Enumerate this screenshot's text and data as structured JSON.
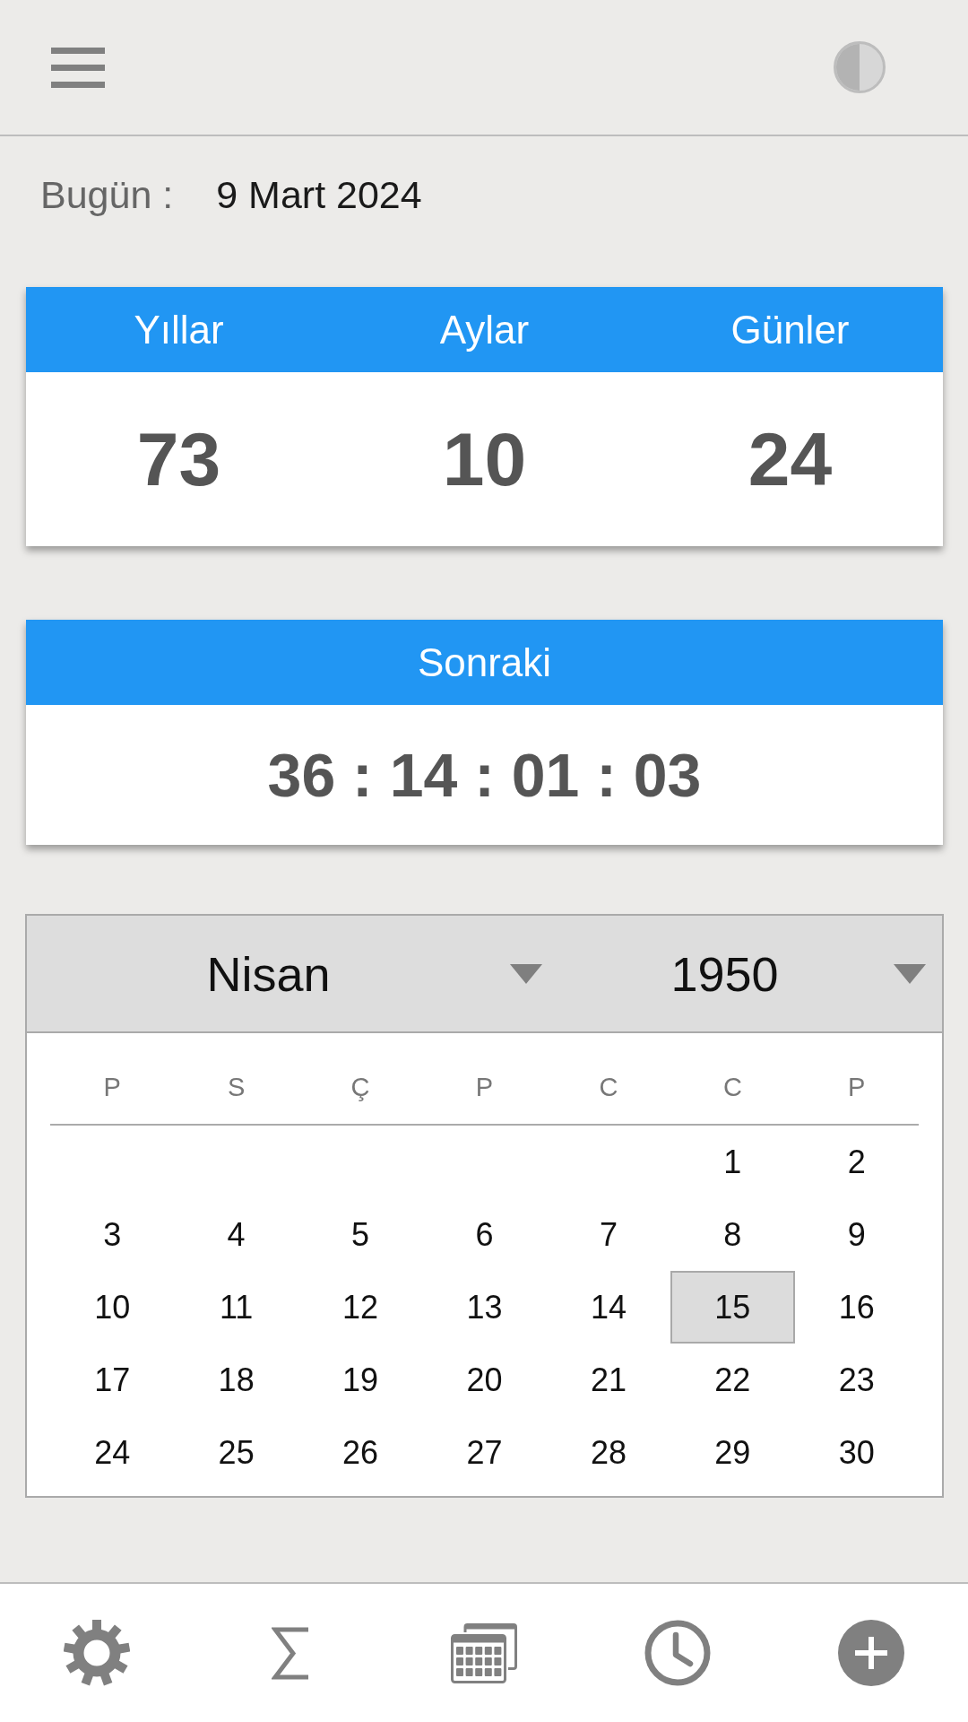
{
  "today": {
    "label": "Bugün :",
    "value": "9 Mart 2024"
  },
  "age_card": {
    "columns": [
      {
        "label": "Yıllar",
        "value": "73"
      },
      {
        "label": "Aylar",
        "value": "10"
      },
      {
        "label": "Günler",
        "value": "24"
      }
    ]
  },
  "next_card": {
    "title": "Sonraki",
    "countdown": "36 : 14 : 01 : 03"
  },
  "calendar": {
    "month": "Nisan",
    "year": "1950",
    "weekdays": [
      "P",
      "S",
      "Ç",
      "P",
      "C",
      "C",
      "P"
    ],
    "weeks": [
      [
        {
          "day": "1",
          "selected": false
        },
        {
          "day": "2",
          "selected": false
        }
      ],
      [
        {
          "day": "3",
          "selected": false
        },
        {
          "day": "4",
          "selected": false
        },
        {
          "day": "5",
          "selected": false
        },
        {
          "day": "6",
          "selected": false
        },
        {
          "day": "7",
          "selected": false
        },
        {
          "day": "8",
          "selected": false
        },
        {
          "day": "9",
          "selected": false
        }
      ],
      [
        {
          "day": "10",
          "selected": false
        },
        {
          "day": "11",
          "selected": false
        },
        {
          "day": "12",
          "selected": false
        },
        {
          "day": "13",
          "selected": false
        },
        {
          "day": "14",
          "selected": false
        },
        {
          "day": "15",
          "selected": true
        },
        {
          "day": "16",
          "selected": false
        }
      ],
      [
        {
          "day": "17",
          "selected": false
        },
        {
          "day": "18",
          "selected": false
        },
        {
          "day": "19",
          "selected": false
        },
        {
          "day": "20",
          "selected": false
        },
        {
          "day": "21",
          "selected": false
        },
        {
          "day": "22",
          "selected": false
        },
        {
          "day": "23",
          "selected": false
        }
      ],
      [
        {
          "day": "24",
          "selected": false
        },
        {
          "day": "25",
          "selected": false
        },
        {
          "day": "26",
          "selected": false
        },
        {
          "day": "27",
          "selected": false
        },
        {
          "day": "28",
          "selected": false
        },
        {
          "day": "29",
          "selected": false
        },
        {
          "day": "30",
          "selected": false
        }
      ]
    ]
  }
}
